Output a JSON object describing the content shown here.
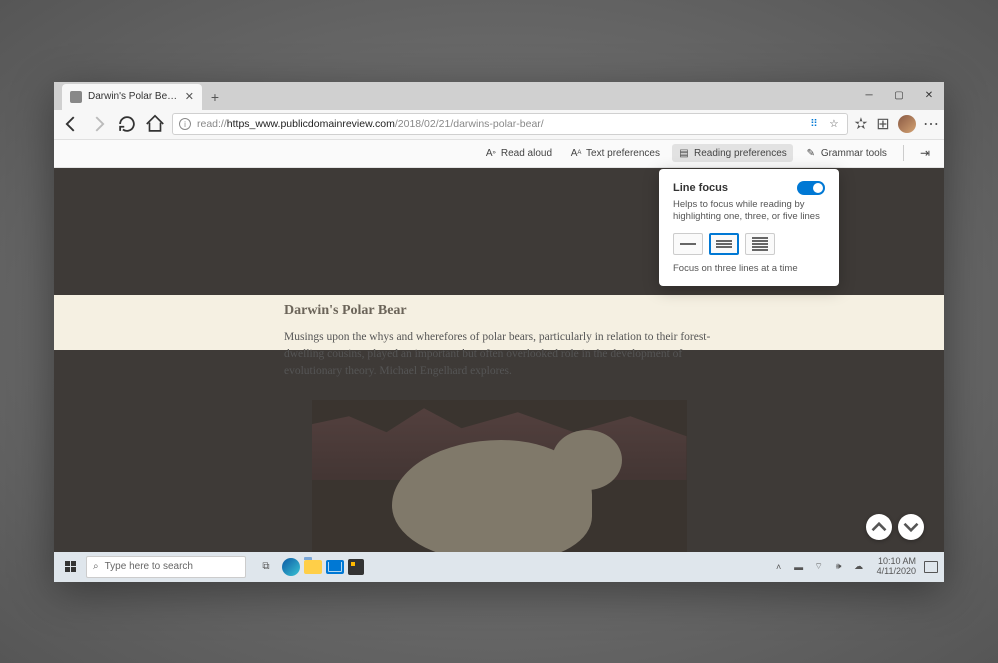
{
  "tab": {
    "title": "Darwin's Polar Bears - The Pu..."
  },
  "url": {
    "prefix": "read://",
    "host": "https_www.publicdomainreview.com",
    "path": "/2018/02/21/darwins-polar-bear/"
  },
  "readToolbar": {
    "readAloud": "Read aloud",
    "textPrefs": "Text preferences",
    "readingPrefs": "Reading preferences",
    "grammar": "Grammar tools"
  },
  "popup": {
    "title": "Line focus",
    "desc": "Helps to focus while reading by highlighting one, three, or five lines",
    "caption": "Focus on three lines at a time"
  },
  "article": {
    "title": "Darwin's Polar Bear",
    "body": "Musings upon the whys and wherefores of polar bears, particularly in relation to their forest-dwelling cousins, played an important but often overlooked role in the development of evolutionary theory. Michael Engelhard explores."
  },
  "taskbar": {
    "searchPlaceholder": "Type here to search",
    "time": "10:10 AM",
    "date": "4/11/2020"
  }
}
